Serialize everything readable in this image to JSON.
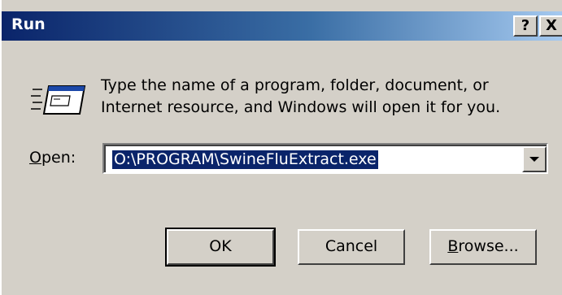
{
  "window": {
    "title": "Run",
    "help_label": "?",
    "close_label": "X"
  },
  "icon": {
    "name": "run-icon"
  },
  "message": {
    "line1": "Type the name of a program, folder, document, or",
    "line2": "Internet resource, and Windows will open it for you."
  },
  "open": {
    "label_accel": "O",
    "label_rest": "pen:",
    "value": "O:\\PROGRAM\\SwineFluExtract.exe"
  },
  "buttons": {
    "ok": "OK",
    "cancel": "Cancel",
    "browse_accel": "B",
    "browse_rest": "rowse..."
  },
  "colors": {
    "title_start": "#0a246a",
    "title_end": "#a6caf0",
    "face": "#d4d0c8",
    "selection": "#0a246a"
  }
}
